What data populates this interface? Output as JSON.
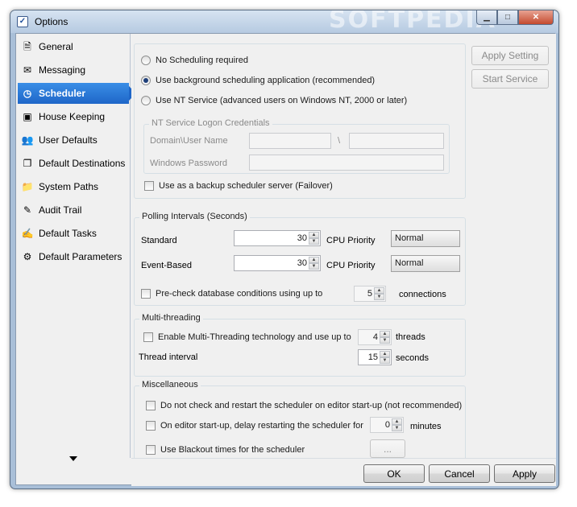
{
  "window": {
    "title": "Options",
    "watermark": "SOFTPEDIA"
  },
  "sidebar": {
    "items": [
      {
        "label": "General",
        "icon": "document-icon"
      },
      {
        "label": "Messaging",
        "icon": "envelope-icon"
      },
      {
        "label": "Scheduler",
        "icon": "clock-icon",
        "active": true
      },
      {
        "label": "House Keeping",
        "icon": "monitor-icon"
      },
      {
        "label": "User Defaults",
        "icon": "users-icon"
      },
      {
        "label": "Default Destinations",
        "icon": "pages-icon"
      },
      {
        "label": "System Paths",
        "icon": "folder-icon"
      },
      {
        "label": "Audit Trail",
        "icon": "pen-icon"
      },
      {
        "label": "Default Tasks",
        "icon": "tasks-icon"
      },
      {
        "label": "Default Parameters",
        "icon": "parameters-icon"
      }
    ]
  },
  "scheduling": {
    "options": [
      {
        "label": "No Scheduling required",
        "selected": false
      },
      {
        "label": "Use background scheduling application (recommended)",
        "selected": true
      },
      {
        "label": "Use NT Service (advanced users on Windows NT, 2000 or later)",
        "selected": false
      }
    ],
    "credentials": {
      "legend": "NT Service Logon Credentials",
      "domain_label": "Domain\\User Name",
      "separator": "\\",
      "password_label": "Windows Password",
      "domain_value": "",
      "user_value": "",
      "password_value": ""
    },
    "backup_label": "Use as a backup scheduler server (Failover)"
  },
  "polling": {
    "legend": "Polling Intervals (Seconds)",
    "standard_label": "Standard",
    "standard_value": "30",
    "event_label": "Event-Based",
    "event_value": "30",
    "cpu_label": "CPU Priority",
    "standard_priority": "Normal",
    "event_priority": "Normal",
    "precheck_label": "Pre-check database conditions using up to",
    "precheck_value": "5",
    "connections_label": "connections"
  },
  "multithreading": {
    "legend": "Multi-threading",
    "enable_label": "Enable Multi-Threading technology and use up to",
    "threads_value": "4",
    "threads_label": "threads",
    "interval_label": "Thread interval",
    "interval_value": "15",
    "seconds_label": "seconds"
  },
  "misc": {
    "legend": "Miscellaneous",
    "no_check_label": "Do not check and restart the scheduler on editor start-up (not recommended)",
    "delay_label": "On editor start-up, delay restarting the scheduler for",
    "delay_value": "0",
    "minutes_label": "minutes",
    "blackout_label": "Use Blackout times for the scheduler",
    "ellipsis": "..."
  },
  "side_buttons": {
    "apply_setting": "Apply Setting",
    "start_service": "Start Service"
  },
  "footer": {
    "ok": "OK",
    "cancel": "Cancel",
    "apply": "Apply"
  }
}
